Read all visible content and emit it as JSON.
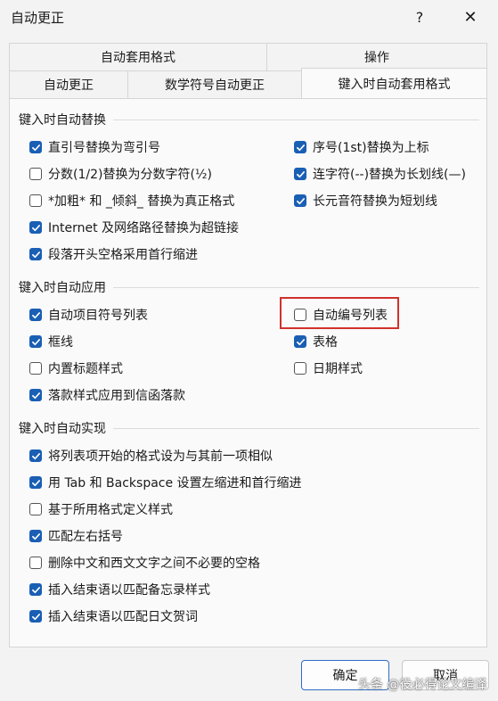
{
  "window": {
    "title": "自动更正",
    "help_icon": "?",
    "close_icon": "✕"
  },
  "tabs": {
    "row1": [
      "自动套用格式",
      "操作"
    ],
    "row2": [
      "自动更正",
      "数学符号自动更正",
      "键入时自动套用格式"
    ],
    "active": "键入时自动套用格式"
  },
  "groups": {
    "replace": {
      "title": "键入时自动替换",
      "left": [
        {
          "label": "直引号替换为弯引号",
          "checked": true
        },
        {
          "label": "分数(1/2)替换为分数字符(½)",
          "checked": false
        },
        {
          "label": "*加粗* 和 _倾斜_ 替换为真正格式",
          "checked": false
        },
        {
          "label": "Internet 及网络路径替换为超链接",
          "checked": true
        },
        {
          "label": "段落开头空格采用首行缩进",
          "checked": true
        }
      ],
      "right": [
        {
          "label": "序号(1st)替换为上标",
          "checked": true
        },
        {
          "label": "连字符(--)替换为长划线(—)",
          "checked": true
        },
        {
          "label": "长元音符替换为短划线",
          "checked": true
        }
      ]
    },
    "apply": {
      "title": "键入时自动应用",
      "left": [
        {
          "label": "自动项目符号列表",
          "checked": true
        },
        {
          "label": "框线",
          "checked": true
        },
        {
          "label": "内置标题样式",
          "checked": false
        },
        {
          "label": "落款样式应用到信函落款",
          "checked": true
        }
      ],
      "right": [
        {
          "label": "自动编号列表",
          "checked": false
        },
        {
          "label": "表格",
          "checked": true
        },
        {
          "label": "日期样式",
          "checked": false
        }
      ]
    },
    "implement": {
      "title": "键入时自动实现",
      "items": [
        {
          "label": "将列表项开始的格式设为与其前一项相似",
          "checked": true
        },
        {
          "label": "用 Tab 和 Backspace 设置左缩进和首行缩进",
          "checked": true
        },
        {
          "label": "基于所用格式定义样式",
          "checked": false
        },
        {
          "label": "匹配左右括号",
          "checked": true
        },
        {
          "label": "删除中文和西文文字之间不必要的空格",
          "checked": false
        },
        {
          "label": "插入结束语以匹配备忘录样式",
          "checked": true
        },
        {
          "label": "插入结束语以匹配日文贺词",
          "checked": true
        }
      ]
    }
  },
  "buttons": {
    "ok": "确定",
    "cancel": "取消"
  },
  "watermark": "头条 @役必得论文编译",
  "colors": {
    "accent": "#1a5fb4",
    "highlight_box": "#d0312d"
  }
}
